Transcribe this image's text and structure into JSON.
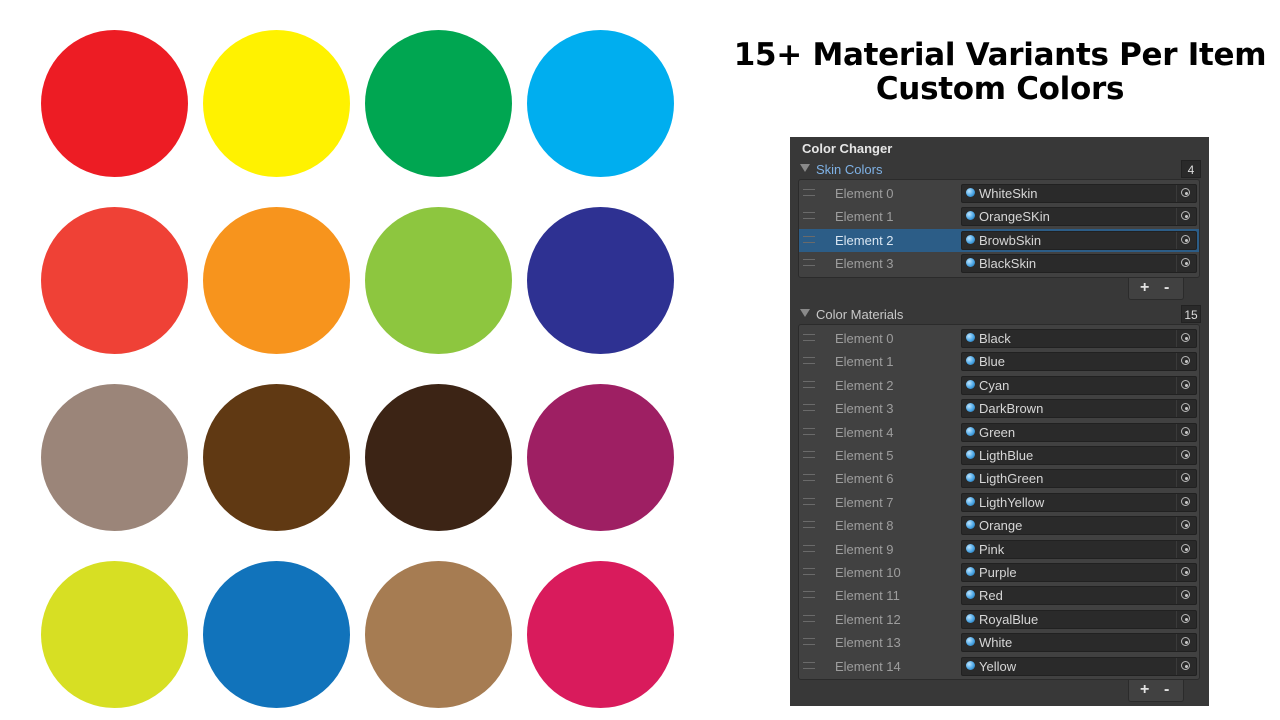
{
  "headline": {
    "line1": "15+ Material Variants Per Item",
    "line2": "Custom Colors"
  },
  "swatch_colors": [
    "#ed1c24",
    "#fff200",
    "#00a651",
    "#00aeef",
    "#ef4136",
    "#f7941d",
    "#8dc63f",
    "#2e3192",
    "#9b8579",
    "#603913",
    "#3c2415",
    "#9e1f63",
    "#d7df23",
    "#1173bb",
    "#a67c52",
    "#d91b5c"
  ],
  "inspector": {
    "title": "Color Changer",
    "skin": {
      "label": "Skin Colors",
      "count": "4",
      "items": [
        {
          "label": "Element 0",
          "value": "WhiteSkin"
        },
        {
          "label": "Element 1",
          "value": "OrangeSKin"
        },
        {
          "label": "Element 2",
          "value": "BrowbSkin"
        },
        {
          "label": "Element 3",
          "value": "BlackSkin"
        }
      ]
    },
    "materials": {
      "label": "Color Materials",
      "count": "15",
      "items": [
        {
          "label": "Element 0",
          "value": "Black"
        },
        {
          "label": "Element 1",
          "value": "Blue"
        },
        {
          "label": "Element 2",
          "value": "Cyan"
        },
        {
          "label": "Element 3",
          "value": "DarkBrown"
        },
        {
          "label": "Element 4",
          "value": "Green"
        },
        {
          "label": "Element 5",
          "value": "LigthBlue"
        },
        {
          "label": "Element 6",
          "value": "LigthGreen"
        },
        {
          "label": "Element 7",
          "value": "LigthYellow"
        },
        {
          "label": "Element 8",
          "value": "Orange"
        },
        {
          "label": "Element 9",
          "value": "Pink"
        },
        {
          "label": "Element 10",
          "value": "Purple"
        },
        {
          "label": "Element 11",
          "value": "Red"
        },
        {
          "label": "Element 12",
          "value": "RoyalBlue"
        },
        {
          "label": "Element 13",
          "value": "White"
        },
        {
          "label": "Element 14",
          "value": "Yellow"
        }
      ]
    },
    "plus_label": "+",
    "minus_label": "-",
    "selected_skin_index": 2,
    "accent_color": "#2c5d87",
    "skin_label_color": "#7fb2e6"
  }
}
